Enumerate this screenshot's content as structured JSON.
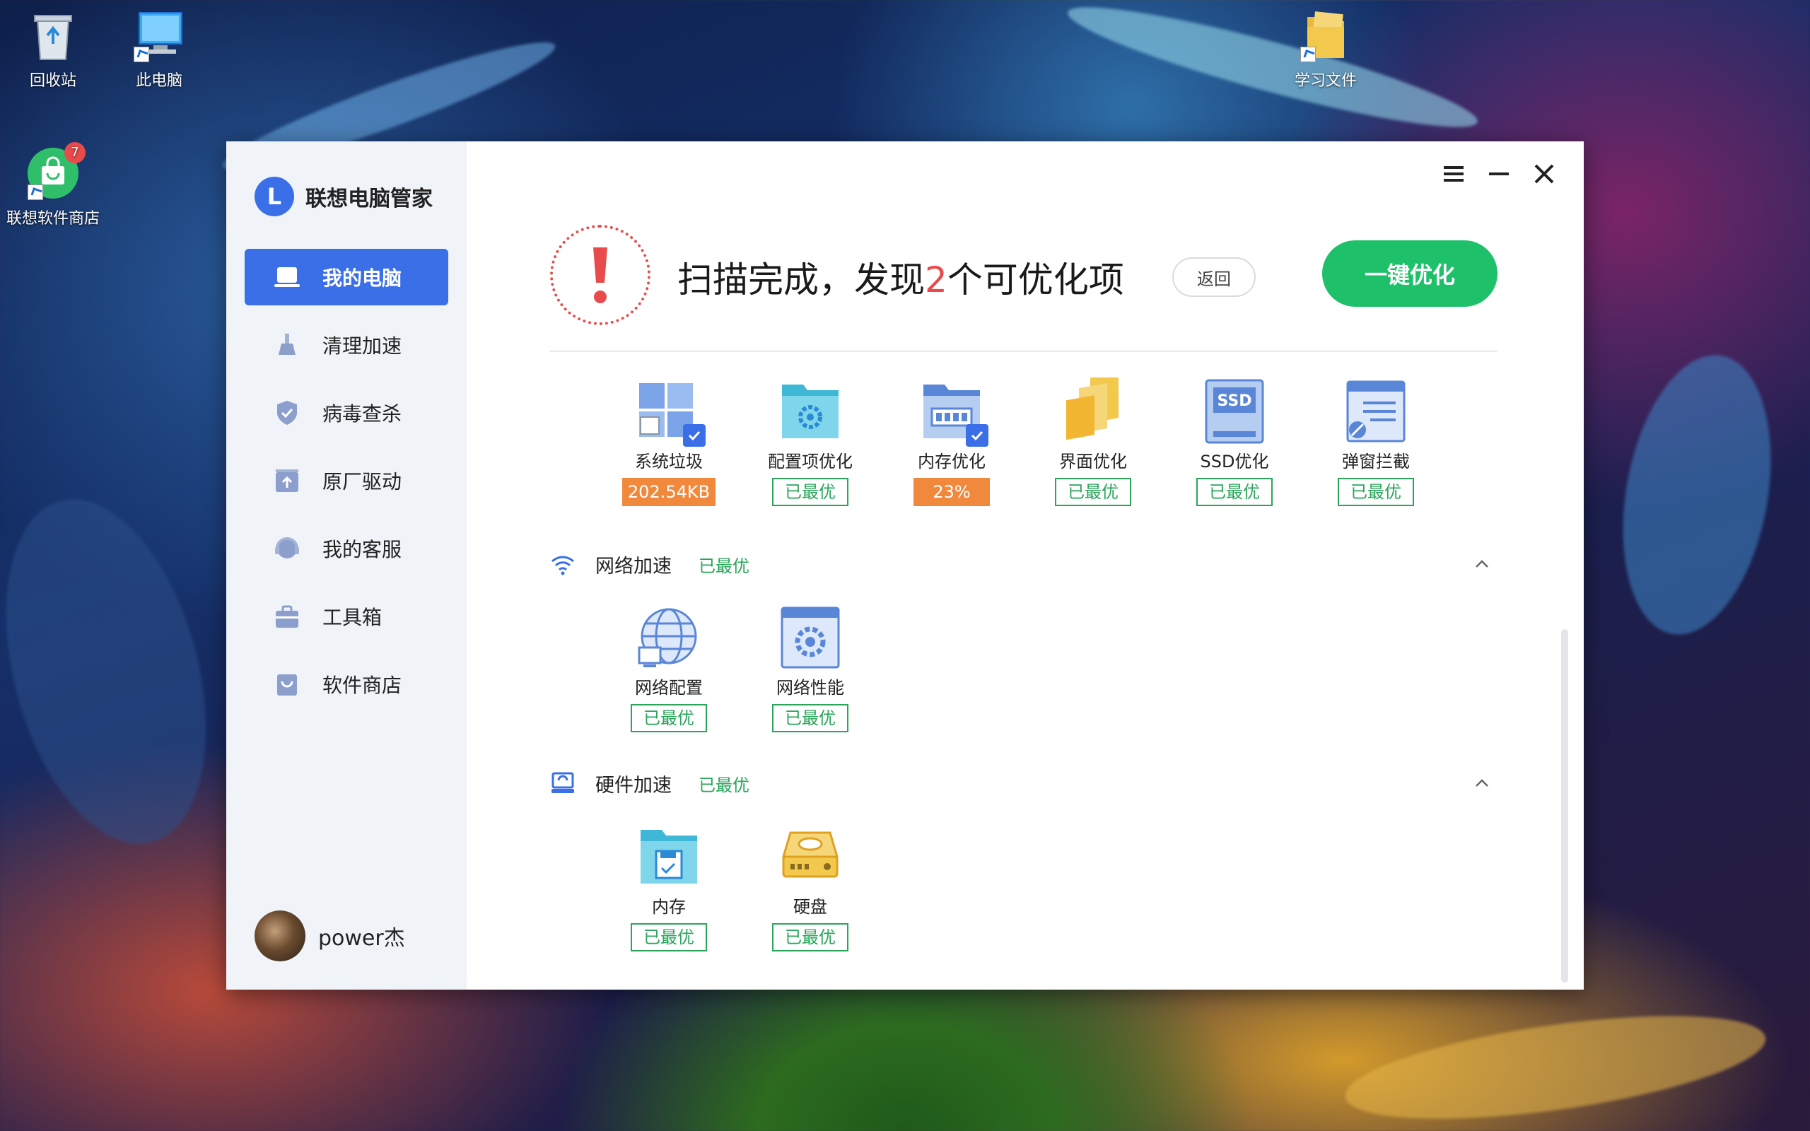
{
  "desktop": {
    "icons": [
      {
        "label": "回收站",
        "icon": "recycle-bin-icon"
      },
      {
        "label": "此电脑",
        "icon": "computer-icon"
      },
      {
        "label": "学习文件",
        "icon": "folder-icon"
      },
      {
        "label": "联想软件商店",
        "icon": "store-bag-icon",
        "badge": "7"
      }
    ]
  },
  "app": {
    "brand_logo": "L",
    "brand_name": "联想电脑管家",
    "nav": [
      {
        "label": "我的电脑",
        "icon": "laptop-icon",
        "active": true
      },
      {
        "label": "清理加速",
        "icon": "broom-icon"
      },
      {
        "label": "病毒查杀",
        "icon": "shield-icon"
      },
      {
        "label": "原厂驱动",
        "icon": "upload-box-icon"
      },
      {
        "label": "我的客服",
        "icon": "headset-icon"
      },
      {
        "label": "工具箱",
        "icon": "toolbox-icon"
      },
      {
        "label": "软件商店",
        "icon": "store-bag-icon"
      }
    ],
    "user": {
      "name": "power杰"
    },
    "window_controls": {
      "menu": "menu-icon",
      "minimize": "minimize-icon",
      "close": "close-icon"
    }
  },
  "scan": {
    "title_prefix": "扫描完成，发现",
    "count": "2",
    "title_suffix": "个可优化项",
    "back_label": "返回",
    "optimize_label": "一键优化"
  },
  "system_items": [
    {
      "label": "系统垃圾",
      "status": "202.54KB",
      "status_type": "warn",
      "icon": "windows-trash-icon"
    },
    {
      "label": "配置项优化",
      "status": "已最优",
      "status_type": "ok",
      "icon": "config-folder-icon"
    },
    {
      "label": "内存优化",
      "status": "23%",
      "status_type": "warn",
      "icon": "memory-chip-icon"
    },
    {
      "label": "界面优化",
      "status": "已最优",
      "status_type": "ok",
      "icon": "interface-pages-icon"
    },
    {
      "label": "SSD优化",
      "status": "已最优",
      "status_type": "ok",
      "icon": "ssd-icon"
    },
    {
      "label": "弹窗拦截",
      "status": "已最优",
      "status_type": "ok",
      "icon": "popup-block-icon"
    }
  ],
  "network": {
    "title": "网络加速",
    "status": "已最优",
    "items": [
      {
        "label": "网络配置",
        "status": "已最优",
        "icon": "globe-icon"
      },
      {
        "label": "网络性能",
        "status": "已最优",
        "icon": "network-gear-icon"
      }
    ]
  },
  "hardware": {
    "title": "硬件加速",
    "status": "已最优",
    "items": [
      {
        "label": "内存",
        "status": "已最优",
        "icon": "memory-folder-icon"
      },
      {
        "label": "硬盘",
        "status": "已最优",
        "icon": "hard-disk-icon"
      }
    ]
  },
  "colors": {
    "accent": "#3b6fe8",
    "ok": "#2aa55a",
    "warn": "#f0893c",
    "alert": "#e84b4b",
    "optimize": "#1fc06a"
  }
}
